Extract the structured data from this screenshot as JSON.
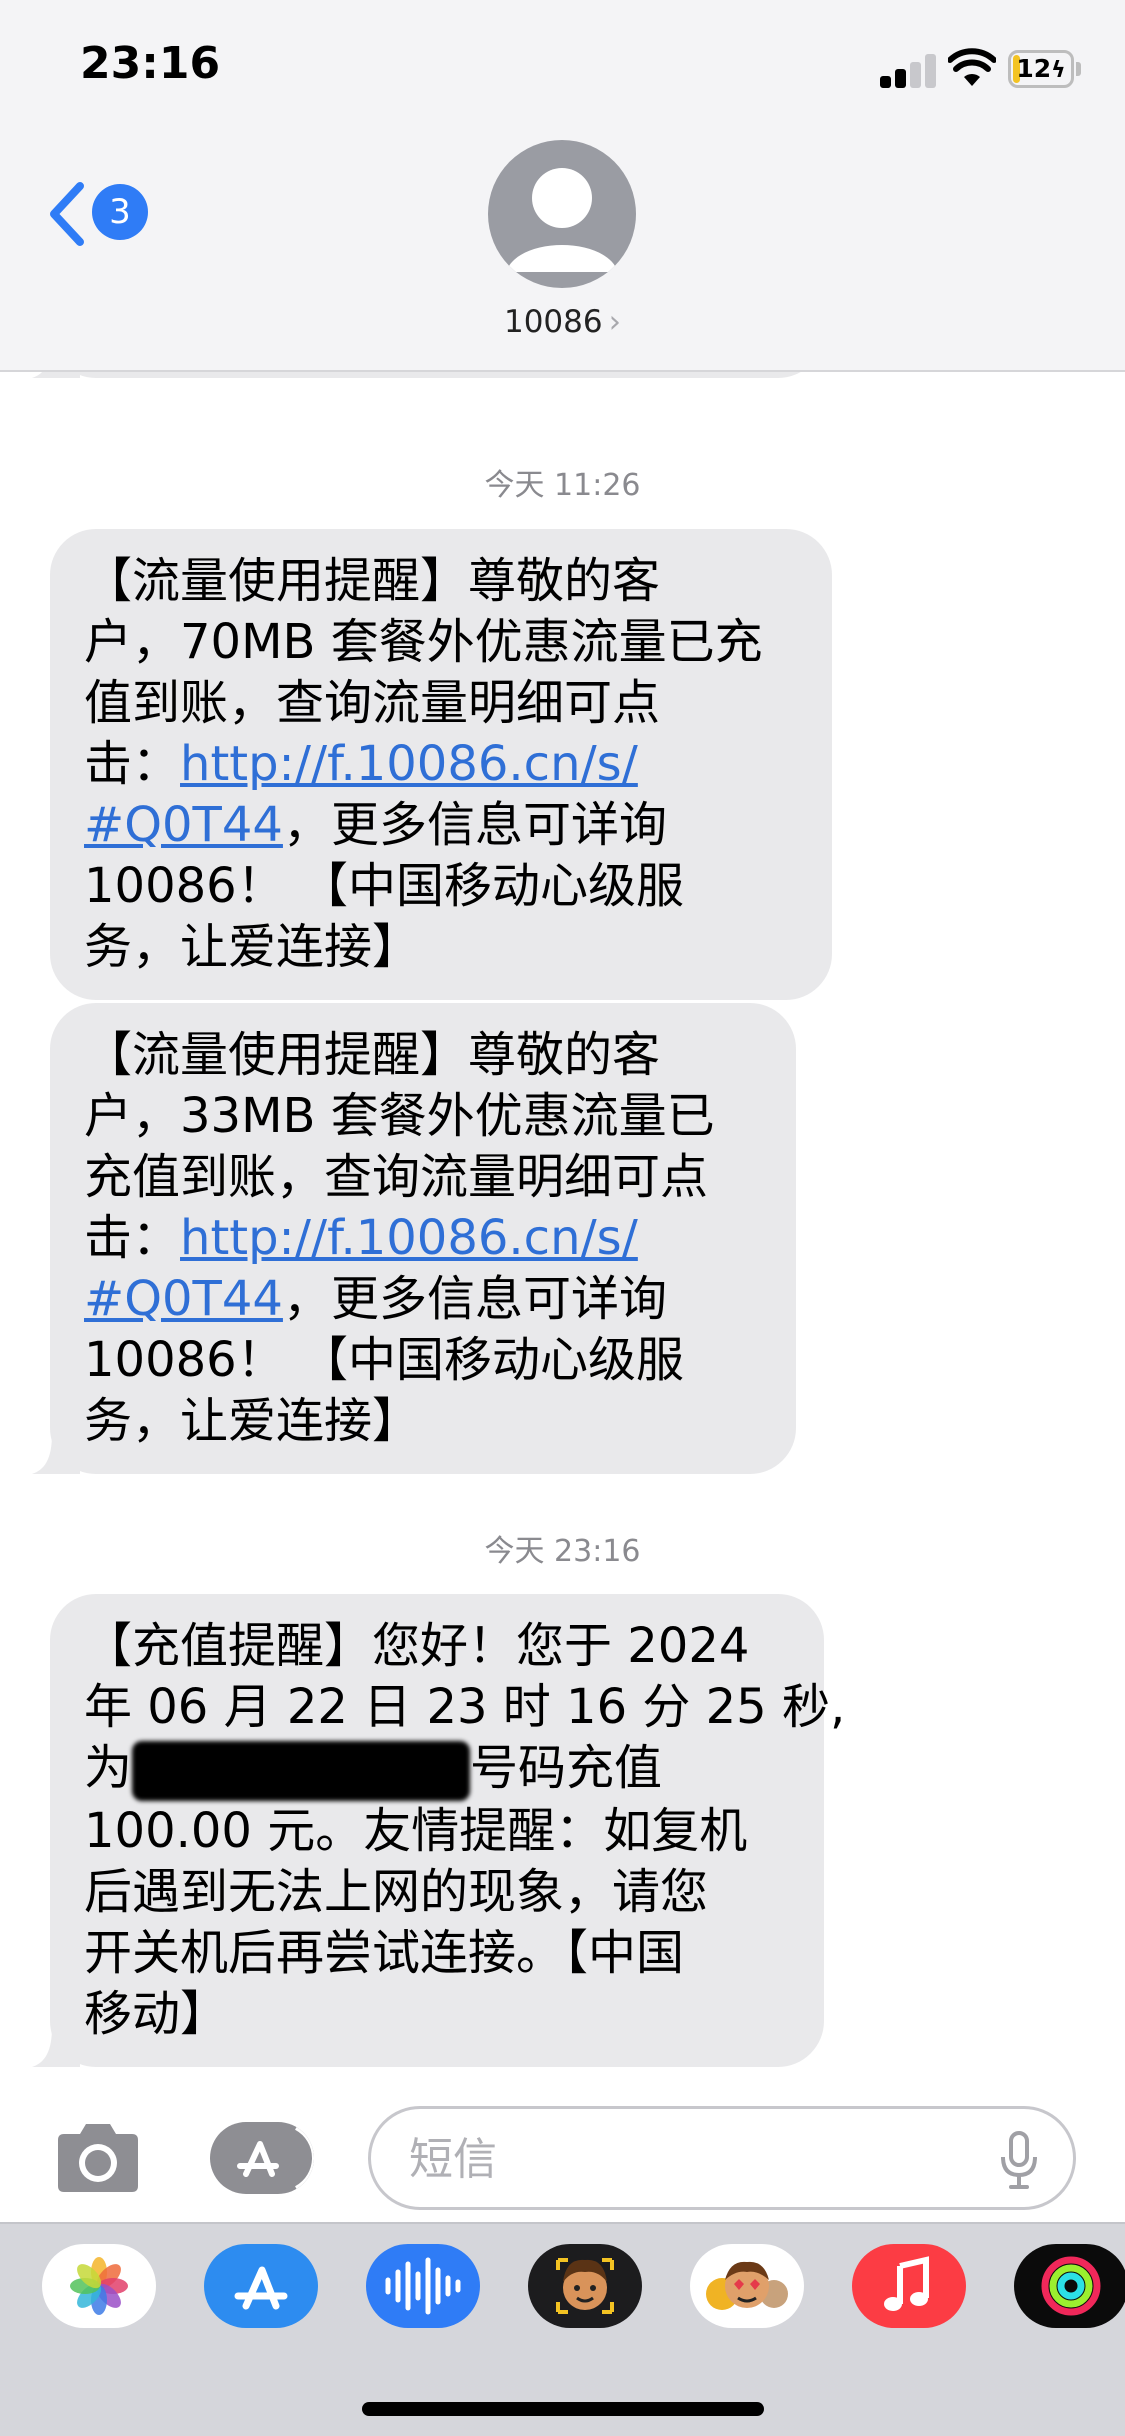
{
  "status_bar": {
    "time": "23:16",
    "battery": "12",
    "battery_level": 0.12
  },
  "header": {
    "back_count": "3",
    "contact_name": "10086",
    "contact_chevron": "›"
  },
  "conversation": {
    "timestamps": [
      "今天 11:26",
      "今天 23:16"
    ],
    "messages": [
      {
        "lines": [
          "【流量使用提醒】尊敬的客",
          "户，70MB 套餐外优惠流量已充",
          "值到账，查询流量明细可点"
        ],
        "link_prefix": "击：",
        "link_line1": "http://f.10086.cn/s/",
        "link_line2": "#Q0T44",
        "after_link": "，更多信息可详询",
        "tail_lines": [
          "10086！ 【中国移动心级服",
          "务，让爱连接】"
        ]
      },
      {
        "lines": [
          "【流量使用提醒】尊敬的客",
          "户，33MB 套餐外优惠流量已",
          "充值到账，查询流量明细可点"
        ],
        "link_prefix": "击：",
        "link_line1": "http://f.10086.cn/s/",
        "link_line2": "#Q0T44",
        "after_link": "，更多信息可详询",
        "tail_lines": [
          "10086！ 【中国移动心级服",
          "务，让爱连接】"
        ]
      },
      {
        "lines": [
          "【充值提醒】您好！您于 2024",
          "年 06 月 22 日 23 时 16 分 25 秒,"
        ],
        "redacted_prefix": "为",
        "redacted_suffix": "号码充值",
        "tail_lines": [
          "100.00 元。友情提醒：如复机",
          "后遇到无法上网的现象，请您",
          "开关机后再尝试连接。【中国",
          "移动】"
        ]
      }
    ]
  },
  "input": {
    "placeholder": "短信",
    "value": ""
  },
  "app_drawer": {
    "apps": [
      "photos-app",
      "app-store-app",
      "audio-message-app",
      "memoji-app",
      "animoji-app",
      "music-app",
      "activity-app"
    ]
  },
  "colors": {
    "bubble": "#e9e9eb",
    "link": "#2f6fd6",
    "accent": "#2f7cf6",
    "music": "#fc3c44"
  }
}
